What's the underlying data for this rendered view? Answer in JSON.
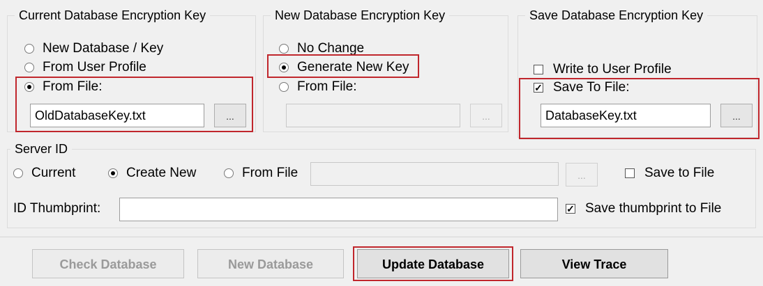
{
  "current_key": {
    "title": "Current Database Encryption Key",
    "options": [
      "New Database / Key",
      "From User Profile",
      "From File:"
    ],
    "selected": 2,
    "file_value": "OldDatabaseKey.txt",
    "browse_label": "..."
  },
  "new_key": {
    "title": "New Database Encryption Key",
    "options": [
      "No Change",
      "Generate New Key",
      "From File:"
    ],
    "selected": 1,
    "file_value": "",
    "browse_label": "..."
  },
  "save_key": {
    "title": "Save Database Encryption Key",
    "write_profile_label": "Write to User Profile",
    "write_profile_checked": false,
    "save_file_label": "Save To File:",
    "save_file_checked": true,
    "file_value": "DatabaseKey.txt",
    "browse_label": "..."
  },
  "server_id": {
    "title": "Server ID",
    "options": [
      "Current",
      "Create New",
      "From File"
    ],
    "selected": 1,
    "file_value": "",
    "browse_label": "...",
    "save_to_file_label": "Save to File",
    "save_to_file_checked": false,
    "thumbprint_label": "ID Thumbprint:",
    "thumbprint_value": "",
    "save_thumbprint_label": "Save thumbprint to File",
    "save_thumbprint_checked": true
  },
  "buttons": {
    "check_db": "Check Database",
    "new_db": "New Database",
    "update_db": "Update Database",
    "view_trace": "View Trace"
  },
  "colors": {
    "highlight": "#c0262c",
    "background": "#f0f0f0"
  }
}
